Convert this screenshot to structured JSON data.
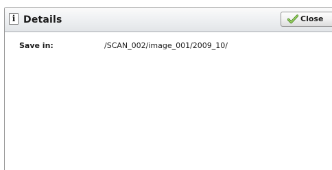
{
  "dialog": {
    "title": "Details",
    "info_icon_glyph": "i",
    "close_label": "Close",
    "close_icon": "checkmark-icon",
    "accent_color": "#7ab648"
  },
  "details": {
    "save_in_label": "Save in:",
    "save_in_value": "/SCAN_002/image_001/2009_10/"
  }
}
